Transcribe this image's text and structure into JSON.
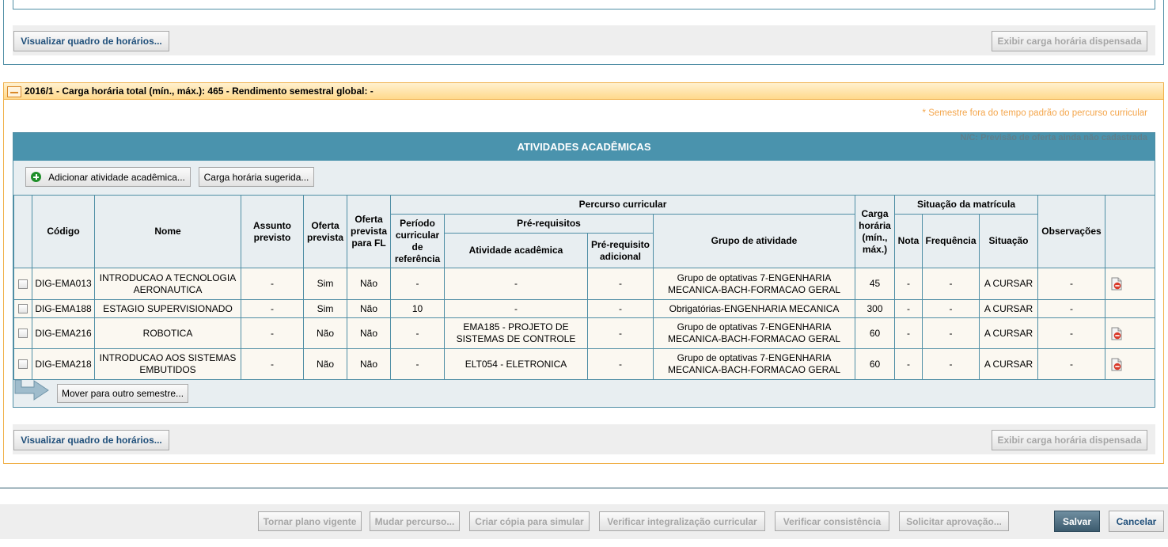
{
  "top_panel": {
    "view_schedule_label": "Visualizar quadro de horários...",
    "show_exempt_label": "Exibir carga horária dispensada"
  },
  "semester": {
    "title": "2016/1 - Carga horária total (mín., máx.): 465 - Rendimento semestral global: -",
    "note_out_of_time": "* Semestre fora do tempo padrão do percurso curricular",
    "note_nc": "N/C: Previsão de oferta ainda não cadastrada",
    "activities_title": "ATIVIDADES ACADÊMICAS",
    "add_activity_label": "Adicionar atividade acadêmica...",
    "suggested_load_label": "Carga horária sugerida...",
    "move_label": "Mover para outro semestre...",
    "view_schedule_label": "Visualizar quadro de horários...",
    "show_exempt_label": "Exibir carga horária dispensada"
  },
  "table": {
    "headers": {
      "codigo": "Código",
      "nome": "Nome",
      "assunto": "Assunto previsto",
      "oferta": "Oferta prevista",
      "oferta_fl": "Oferta prevista para FL",
      "percurso": "Percurso curricular",
      "periodo": "Período curricular de referência",
      "prereq": "Pré-requisitos",
      "atividade": "Atividade acadêmica",
      "prereq_adicional": "Pré-requisito adicional",
      "grupo": "Grupo de atividade",
      "carga": "Carga horária (mín., máx.)",
      "situacao_matricula": "Situação da matrícula",
      "nota": "Nota",
      "frequencia": "Frequência",
      "situacao": "Situação",
      "observacoes": "Observações"
    },
    "rows": [
      {
        "codigo": "DIG-EMA013",
        "nome": "INTRODUCAO A TECNOLOGIA AERONAUTICA",
        "assunto": "-",
        "oferta": "Sim",
        "oferta_fl": "Não",
        "periodo": "-",
        "atividade": "-",
        "prereq_adicional": "-",
        "grupo": "Grupo de optativas 7-ENGENHARIA MECANICA-BACH-FORMACAO GERAL",
        "carga": "45",
        "nota": "-",
        "frequencia": "-",
        "situacao": "A CURSAR",
        "observacoes": "-"
      },
      {
        "codigo": "DIG-EMA188",
        "nome": "ESTAGIO SUPERVISIONADO",
        "assunto": "-",
        "oferta": "Sim",
        "oferta_fl": "Não",
        "periodo": "10",
        "atividade": "-",
        "prereq_adicional": "-",
        "grupo": "Obrigatórias-ENGENHARIA MECANICA",
        "carga": "300",
        "nota": "-",
        "frequencia": "-",
        "situacao": "A CURSAR",
        "observacoes": "-"
      },
      {
        "codigo": "DIG-EMA216",
        "nome": "ROBOTICA",
        "assunto": "-",
        "oferta": "Não",
        "oferta_fl": "Não",
        "periodo": "-",
        "atividade": "EMA185 - PROJETO DE SISTEMAS DE CONTROLE",
        "prereq_adicional": "-",
        "grupo": "Grupo de optativas 7-ENGENHARIA MECANICA-BACH-FORMACAO GERAL",
        "carga": "60",
        "nota": "-",
        "frequencia": "-",
        "situacao": "A CURSAR",
        "observacoes": "-"
      },
      {
        "codigo": "DIG-EMA218",
        "nome": "INTRODUCAO AOS SISTEMAS EMBUTIDOS",
        "assunto": "-",
        "oferta": "Não",
        "oferta_fl": "Não",
        "periodo": "-",
        "atividade": "ELT054 - ELETRONICA",
        "prereq_adicional": "-",
        "grupo": "Grupo de optativas 7-ENGENHARIA MECANICA-BACH-FORMACAO GERAL",
        "carga": "60",
        "nota": "-",
        "frequencia": "-",
        "situacao": "A CURSAR",
        "observacoes": "-"
      }
    ]
  },
  "bottom_bar": {
    "tornar_vigente": "Tornar plano vigente",
    "mudar_percurso": "Mudar percurso...",
    "criar_copia": "Criar cópia para simular",
    "verificar_integralizacao": "Verificar integralização curricular",
    "verificar_consistencia": "Verificar consistência",
    "solicitar_aprovacao": "Solicitar aprovação...",
    "salvar": "Salvar",
    "cancelar": "Cancelar"
  },
  "icons": {
    "delete_row": "delete-document-icon",
    "add": "plus-circle-icon",
    "move": "move-arrow-icon",
    "collapse": "collapse-minus-icon"
  },
  "colors": {
    "header_blue": "#4a93ad",
    "semester_border": "#f0b048",
    "note_orange": "#f4a64c",
    "delete_red": "#d93a2b"
  }
}
